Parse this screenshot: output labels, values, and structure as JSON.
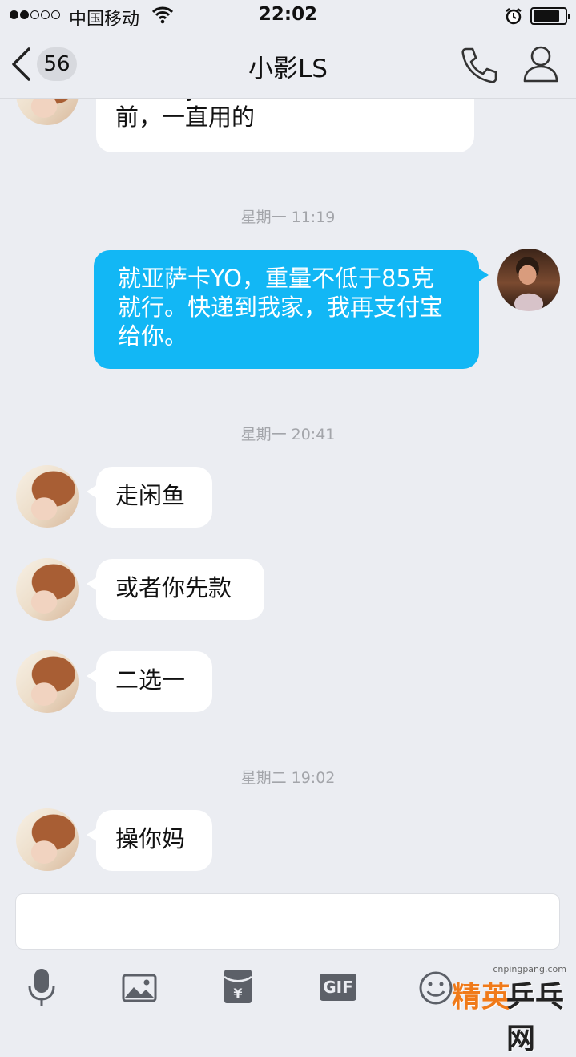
{
  "status_bar": {
    "carrier": "中国移动",
    "time": "22:02",
    "signal_bars_filled": 2,
    "signal_bars_total": 5,
    "battery_level": 0.85
  },
  "nav": {
    "back_count": "56",
    "title": "小影LS"
  },
  "messages": [
    {
      "type": "text",
      "direction": "in",
      "text": "亚萨卡yo是张怡宁签约蝴蝶之前，一直用的",
      "partial": true
    },
    {
      "type": "time",
      "text": "星期一 11:19"
    },
    {
      "type": "text",
      "direction": "out",
      "text": "就亚萨卡YO，重量不低于85克就行。快递到我家，我再支付宝给你。"
    },
    {
      "type": "time",
      "text": "星期一 20:41"
    },
    {
      "type": "text",
      "direction": "in",
      "text": "走闲鱼"
    },
    {
      "type": "text",
      "direction": "in",
      "text": "或者你先款"
    },
    {
      "type": "text",
      "direction": "in",
      "text": "二选一"
    },
    {
      "type": "time",
      "text": "星期二 19:02"
    },
    {
      "type": "text",
      "direction": "in",
      "text": "操你妈"
    }
  ],
  "input": {
    "value": "",
    "placeholder": ""
  },
  "toolbar": [
    {
      "icon": "microphone-icon"
    },
    {
      "icon": "image-icon"
    },
    {
      "icon": "red-packet-icon",
      "glyph": "¥"
    },
    {
      "icon": "gif-icon",
      "label": "GIF"
    },
    {
      "icon": "emoji-icon"
    }
  ],
  "watermark": {
    "url": "cnpingpang.com",
    "text_left": "精英",
    "text_right": "乒乓网"
  },
  "colors": {
    "background": "#ebedf2",
    "outgoing_bubble": "#12b7f5",
    "incoming_bubble": "#ffffff",
    "timestamp": "#a3a5aa",
    "icon": "#5c6068"
  }
}
